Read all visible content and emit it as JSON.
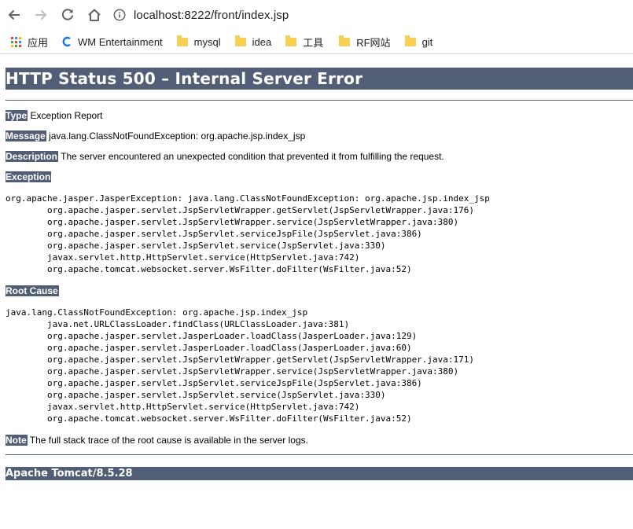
{
  "browser": {
    "url": "localhost:8222/front/index.jsp",
    "bookmarks": [
      {
        "label": "应用",
        "icon": "apps-grid-icon"
      },
      {
        "label": "WM Entertainment",
        "icon": "site-c-icon"
      },
      {
        "label": "mysql",
        "icon": "folder-icon"
      },
      {
        "label": "idea",
        "icon": "folder-icon"
      },
      {
        "label": "工具",
        "icon": "folder-icon"
      },
      {
        "label": "RF网站",
        "icon": "folder-icon"
      },
      {
        "label": "git",
        "icon": "folder-icon"
      }
    ]
  },
  "error": {
    "title": "HTTP Status 500 – Internal Server Error",
    "type_label": "Type",
    "type_value": "Exception Report",
    "message_label": "Message",
    "message_value": "java.lang.ClassNotFoundException: org.apache.jsp.index_jsp",
    "description_label": "Description",
    "description_value": "The server encountered an unexpected condition that prevented it from fulfilling the request.",
    "exception_label": "Exception",
    "exception_trace": "org.apache.jasper.JasperException: java.lang.ClassNotFoundException: org.apache.jsp.index_jsp\n\torg.apache.jasper.servlet.JspServletWrapper.getServlet(JspServletWrapper.java:176)\n\torg.apache.jasper.servlet.JspServletWrapper.service(JspServletWrapper.java:380)\n\torg.apache.jasper.servlet.JspServlet.serviceJspFile(JspServlet.java:386)\n\torg.apache.jasper.servlet.JspServlet.service(JspServlet.java:330)\n\tjavax.servlet.http.HttpServlet.service(HttpServlet.java:742)\n\torg.apache.tomcat.websocket.server.WsFilter.doFilter(WsFilter.java:52)",
    "root_cause_label": "Root Cause",
    "root_cause_trace": "java.lang.ClassNotFoundException: org.apache.jsp.index_jsp\n\tjava.net.URLClassLoader.findClass(URLClassLoader.java:381)\n\torg.apache.jasper.servlet.JasperLoader.loadClass(JasperLoader.java:129)\n\torg.apache.jasper.servlet.JasperLoader.loadClass(JasperLoader.java:60)\n\torg.apache.jasper.servlet.JspServletWrapper.getServlet(JspServletWrapper.java:171)\n\torg.apache.jasper.servlet.JspServletWrapper.service(JspServletWrapper.java:380)\n\torg.apache.jasper.servlet.JspServlet.serviceJspFile(JspServlet.java:386)\n\torg.apache.jasper.servlet.JspServlet.service(JspServlet.java:330)\n\tjavax.servlet.http.HttpServlet.service(HttpServlet.java:742)\n\torg.apache.tomcat.websocket.server.WsFilter.doFilter(WsFilter.java:52)",
    "note_label": "Note",
    "note_value": "The full stack trace of the root cause is available in the server logs.",
    "footer": "Apache Tomcat/8.5.28"
  },
  "colors": {
    "tomcat_header": "#525d76",
    "folder": "#f7cf53"
  }
}
